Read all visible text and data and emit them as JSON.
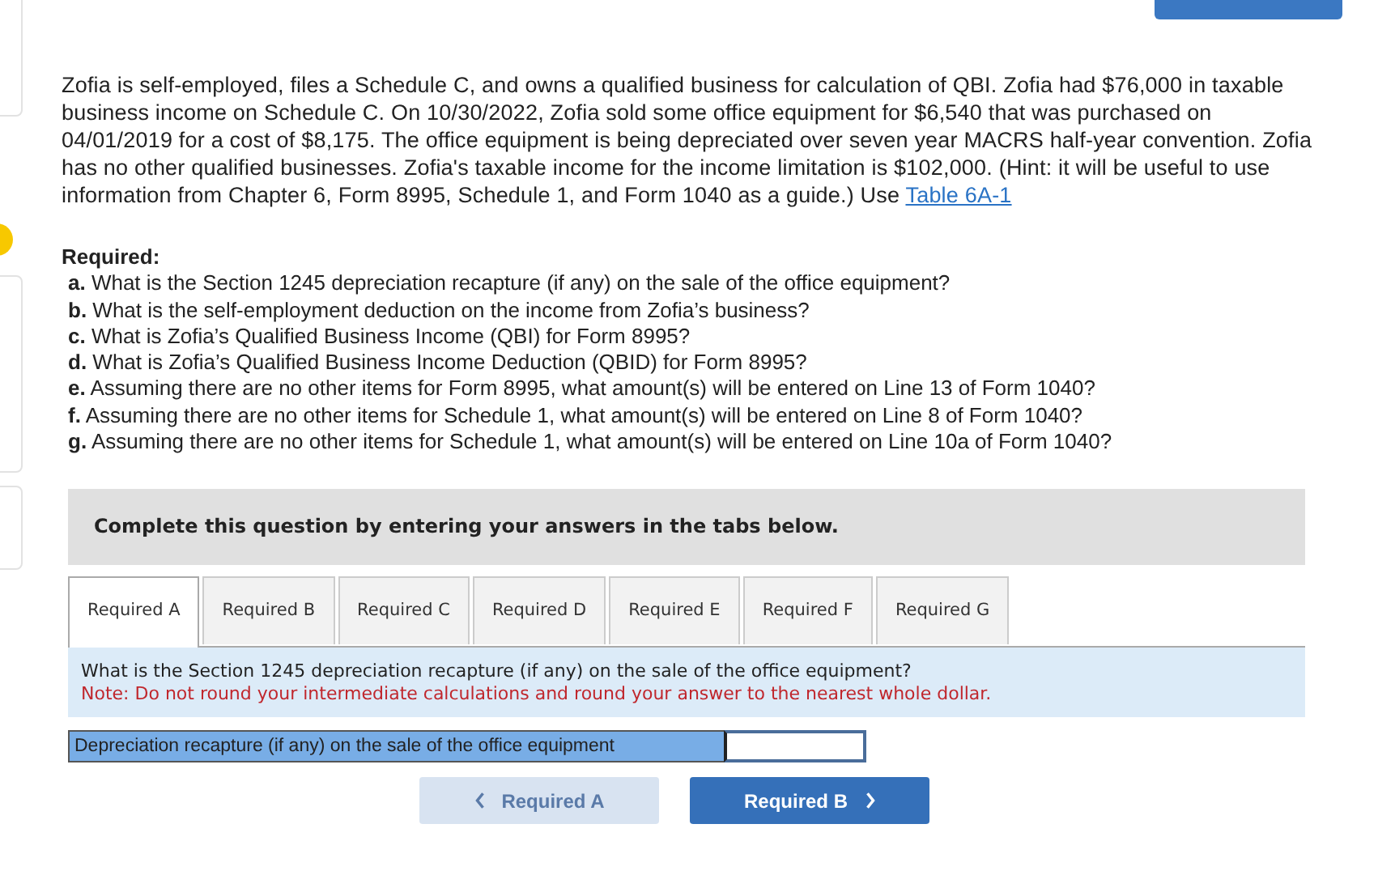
{
  "problem": {
    "text": "Zofia is self-employed, files a Schedule C, and owns a qualified business for calculation of QBI. Zofia had $76,000 in taxable business income on Schedule C. On 10/30/2022, Zofia sold some office equipment for $6,540 that was purchased on 04/01/2019 for a cost of $8,175. The office equipment is being depreciated over seven year MACRS half-year convention. Zofia has no other qualified businesses. Zofia's taxable income for the income limitation is $102,000. (Hint: it will be useful to use information from Chapter 6, Form 8995, Schedule 1, and Form 1040 as a guide.) Use",
    "link": "Table 6A-1"
  },
  "required": {
    "heading": "Required:",
    "items": [
      "**a.** What is the Section 1245 depreciation recapture (if any) on the sale of the office equipment?",
      "**b.** What is the self-employment deduction on the income from Zofia’s business?",
      "**c.** What is Zofia’s Qualified Business Income (QBI) for Form 8995?",
      "**d.** What is Zofia’s Qualified Business Income Deduction (QBID) for Form 8995?",
      "**e.** Assuming there are no other items for Form 8995, what amount(s) will be entered on Line 13 of Form 1040?",
      "**f.** Assuming there are no other items for Schedule 1, what amount(s) will be entered on Line 8 of Form 1040?",
      "**g.** Assuming there are no other items for Schedule 1, what amount(s) will be entered on Line 10a of Form 1040?"
    ]
  },
  "instruction": "Complete this question by entering your answers in the tabs below.",
  "tabs": [
    {
      "label": "Required A",
      "selected": true
    },
    {
      "label": "Required B",
      "selected": false
    },
    {
      "label": "Required C",
      "selected": false
    },
    {
      "label": "Required D",
      "selected": false
    },
    {
      "label": "Required E",
      "selected": false
    },
    {
      "label": "Required F",
      "selected": false
    },
    {
      "label": "Required G",
      "selected": false
    }
  ],
  "question": {
    "text": "What is the Section 1245 depreciation recapture (if any) on the sale of the office equipment?",
    "note": "Note: Do not round your intermediate calculations and round your answer to the nearest whole dollar."
  },
  "answer_row": {
    "label": "Depreciation recapture (if any) on the sale of the office equipment"
  },
  "nav": [
    {
      "label": "Required A",
      "kind": "prev",
      "disabled": true
    },
    {
      "label": "Required B",
      "kind": "next",
      "disabled": false
    }
  ]
}
